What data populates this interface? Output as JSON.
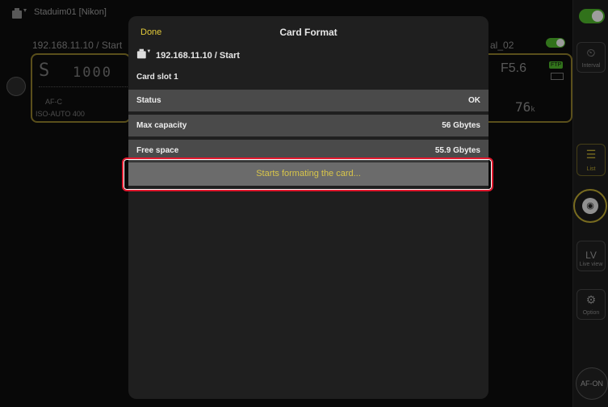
{
  "background": {
    "camera_title": "Staduim01 [Nikon]",
    "left_connection": "192.168.11.10 / Start",
    "right_connection_suffix": "al_02",
    "shutter_speed": "1000",
    "exposure_mode": "S",
    "af_mode": "AF-C",
    "iso": "ISO-AUTO",
    "iso_value": "400",
    "aperture": "F5.6",
    "ftp_badge": "FTP",
    "remaining_shots": "76",
    "remaining_suffix": "k"
  },
  "sidebar": {
    "interval_label": "Interval",
    "list_label": "List",
    "lv_label": "LV",
    "live_view_label": "Live view",
    "option_label": "Option",
    "af_on_label": "AF-ON"
  },
  "modal": {
    "done_label": "Done",
    "title": "Card Format",
    "source": "192.168.11.10 / Start",
    "slot_label": "Card slot 1",
    "rows": [
      {
        "label": "Status",
        "value": "OK"
      },
      {
        "label": "Max capacity",
        "value": "56 Gbytes"
      },
      {
        "label": "Free space",
        "value": "55.9 Gbytes"
      }
    ],
    "format_button": "Starts formating the card..."
  },
  "colors": {
    "accent": "#e2c93a",
    "toggle_on": "#4caf2a",
    "highlight": "#e0182d"
  }
}
